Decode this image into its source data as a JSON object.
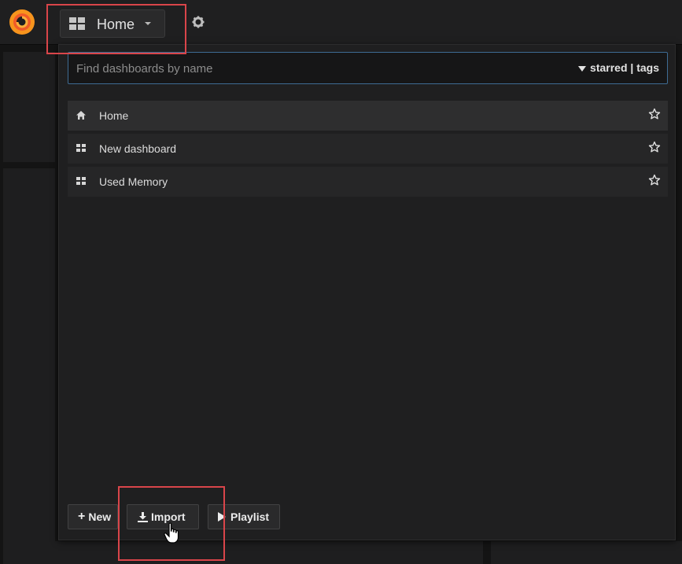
{
  "navbar": {
    "dashboard_title": "Home",
    "icons": [
      "grafana-logo",
      "dashboard-grid-icon",
      "chevron-down-icon",
      "gear-icon"
    ]
  },
  "search": {
    "placeholder": "Find dashboards by name",
    "value": "",
    "filter_label": "starred | tags"
  },
  "dashboards": [
    {
      "name": "Home",
      "icon": "home-icon",
      "starred": false
    },
    {
      "name": "New dashboard",
      "icon": "dashboard-grid-icon",
      "starred": false
    },
    {
      "name": "Used Memory",
      "icon": "dashboard-grid-icon",
      "starred": false
    }
  ],
  "footer": {
    "new_label": "New",
    "import_label": "Import",
    "playlist_label": "Playlist"
  },
  "colors": {
    "highlight": "#d9454a",
    "search_border": "#3e6c94",
    "background": "#1f1f20"
  }
}
